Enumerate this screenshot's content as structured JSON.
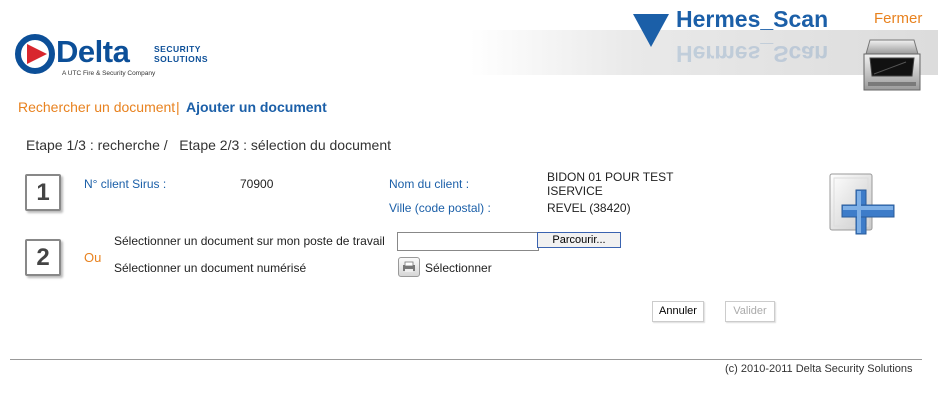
{
  "header": {
    "app_title": "Hermes_Scan",
    "app_title_reflection": "Hermes_Scan",
    "close_label": "Fermer",
    "logo": {
      "name": "Delta",
      "security": "SECURITY",
      "solutions": "SOLUTIONS",
      "tagline": "A UTC Fire & Security Company"
    }
  },
  "nav": {
    "search_label": "Rechercher un document",
    "separator": "|",
    "add_label": "Ajouter un document"
  },
  "steps": {
    "text": "Etape 1/3 : recherche /   Etape 2/3 : sélection du document"
  },
  "client": {
    "step_number": "1",
    "sirus_label": "N° client Sirus :",
    "sirus_value": "70900",
    "name_label": "Nom du client :",
    "name_line1": "BIDON 01 POUR TEST",
    "name_line2": "ISERVICE",
    "city_label": "Ville (code postal) :",
    "city_value": "REVEL (38420)"
  },
  "document": {
    "step_number": "2",
    "or_label": "Ou",
    "local_label": "Sélectionner un document sur mon poste de travail",
    "file_value": "",
    "browse_label": "Parcourir...",
    "scanned_label": "Sélectionner un document numérisé",
    "select_label": "Sélectionner"
  },
  "actions": {
    "cancel_label": "Annuler",
    "validate_label": "Valider"
  },
  "footer": {
    "copyright": "(c) 2010-2011 Delta Security Solutions"
  },
  "colors": {
    "brand_blue": "#1b5fa8",
    "accent_orange": "#e8821f",
    "logo_blue": "#0c4f98",
    "logo_red": "#d8262e"
  }
}
